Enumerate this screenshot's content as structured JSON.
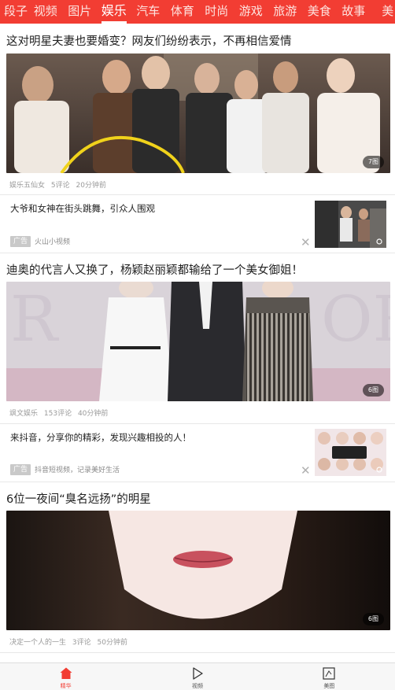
{
  "tabs": [
    {
      "label": "段子"
    },
    {
      "label": "视频"
    },
    {
      "label": "图片"
    },
    {
      "label": "娱乐",
      "active": true
    },
    {
      "label": "汽车"
    },
    {
      "label": "体育"
    },
    {
      "label": "时尚"
    },
    {
      "label": "游戏"
    },
    {
      "label": "旅游"
    },
    {
      "label": "美食"
    },
    {
      "label": "故事"
    },
    {
      "label": "美"
    }
  ],
  "articles": [
    {
      "title": "这对明星夫妻也要婚变？网友们纷纷表示，不再相信爱情",
      "image_count": "7图",
      "source": "娱乐五仙女",
      "comments": "5评论",
      "time": "20分钟前"
    },
    {
      "title": "迪奥的代言人又换了，杨颖赵丽颖都输给了一个美女御姐！",
      "image_count": "6图",
      "source": "飒文娱乐",
      "comments": "153评论",
      "time": "40分钟前"
    },
    {
      "title": "6位一夜间“臭名远扬”的明星",
      "image_count": "6图",
      "source": "决定一个人的一生",
      "comments": "3评论",
      "time": "50分钟前"
    }
  ],
  "ads": [
    {
      "title": "大爷和女神在街头跳舞，引众人围观",
      "label": "广告",
      "source": "火山小视频"
    },
    {
      "title": "来抖音，分享你的精彩，发现兴趣相投的人！",
      "label": "广告",
      "source": "抖音短视频，记录美好生活"
    }
  ],
  "bottom_nav": [
    {
      "label": "精华",
      "icon": "home-icon",
      "active": true
    },
    {
      "label": "视频",
      "icon": "play-icon"
    },
    {
      "label": "美图",
      "icon": "picture-icon"
    }
  ],
  "colors": {
    "accent": "#f23d33",
    "meta_text": "#9a9a9a",
    "ad_label_bg": "#c9c9c9"
  }
}
